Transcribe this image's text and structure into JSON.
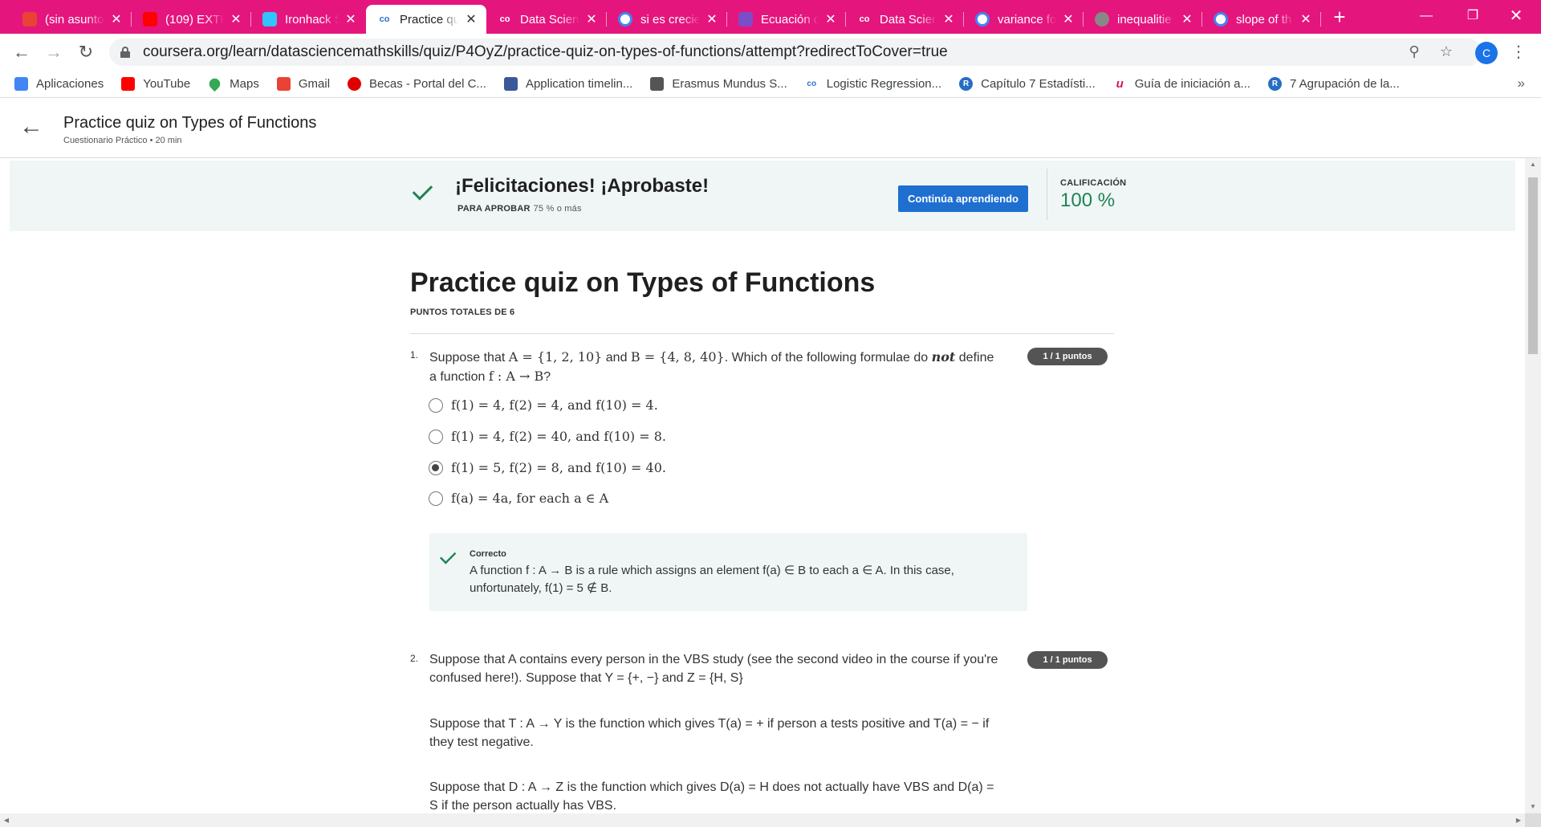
{
  "browser": {
    "tabs": [
      {
        "label": "(sin asunto",
        "favicon": "gmail-icon",
        "color": "#ea4335",
        "active": false
      },
      {
        "label": "(109) EXTR",
        "favicon": "youtube-icon",
        "color": "#ff0000",
        "active": false
      },
      {
        "label": "Ironhack S",
        "favicon": "ironhack-icon",
        "color": "#32c3ff",
        "active": false
      },
      {
        "label": "Practice qu",
        "favicon": "coursera-icon",
        "color": "#2a73cc",
        "active": true
      },
      {
        "label": "Data Scien",
        "favicon": "coursera-icon",
        "color": "#2a73cc",
        "active": false
      },
      {
        "label": "si es crecie",
        "favicon": "google-icon",
        "color": "#ffffff",
        "active": false
      },
      {
        "label": "Ecuación d",
        "favicon": "sparkle-icon",
        "color": "#7a4ec9",
        "active": false
      },
      {
        "label": "Data Scien",
        "favicon": "coursera-icon",
        "color": "#2a73cc",
        "active": false
      },
      {
        "label": "variance fo",
        "favicon": "google-icon",
        "color": "#ffffff",
        "active": false
      },
      {
        "label": "inequalitie",
        "favicon": "globe-icon",
        "color": "#888888",
        "active": false
      },
      {
        "label": "slope of th",
        "favicon": "google-icon",
        "color": "#ffffff",
        "active": false
      }
    ],
    "url_host": "coursera.org",
    "url_path": "/learn/datasciencemathskills/quiz/P4OyZ/practice-quiz-on-types-of-functions/attempt?redirectToCover=true",
    "avatar_letter": "C",
    "bookmarks": [
      {
        "label": "Aplicaciones",
        "icon": "apps-grid-icon",
        "color": "#4285f4"
      },
      {
        "label": "YouTube",
        "icon": "youtube-icon",
        "color": "#ff0000"
      },
      {
        "label": "Maps",
        "icon": "maps-pin-icon",
        "color": "#34a853"
      },
      {
        "label": "Gmail",
        "icon": "gmail-icon",
        "color": "#ea4335"
      },
      {
        "label": "Becas - Portal del C...",
        "icon": "red-circle-icon",
        "color": "#e00000"
      },
      {
        "label": "Application timelin...",
        "icon": "application-icon",
        "color": "#3b5998"
      },
      {
        "label": "Erasmus Mundus S...",
        "icon": "erasmus-icon",
        "color": "#555555"
      },
      {
        "label": "Logistic Regression...",
        "icon": "coursera-icon",
        "color": "#2a73cc"
      },
      {
        "label": "Capítulo 7 Estadísti...",
        "icon": "r-icon",
        "color": "#276dc3"
      },
      {
        "label": "Guía de iniciación a...",
        "icon": "u-icon",
        "color": "#e0115f"
      },
      {
        "label": "7 Agrupación de la...",
        "icon": "r-icon",
        "color": "#276dc3"
      }
    ]
  },
  "header": {
    "title": "Practice quiz on Types of Functions",
    "subtitle": "Cuestionario Práctico • 20 min"
  },
  "banner": {
    "title": "¡Felicitaciones! ¡Aprobaste!",
    "pass_label": "PARA APROBAR",
    "pass_value": "75 % o más",
    "continue_label": "Continúa aprendiendo",
    "grade_label": "CALIFICACIÓN",
    "grade_value": "100 %"
  },
  "quiz": {
    "title": "Practice quiz on Types of Functions",
    "total_points": "PUNTOS TOTALES DE 6",
    "q1": {
      "number": "1.",
      "points": "1 / 1 puntos",
      "text_a": "Suppose that",
      "set_a": "A = {1, 2, 10}",
      "text_and": "and",
      "set_b": "B = {4, 8, 40}",
      "text_b": ". Which of the following formulae do",
      "emph": "not",
      "text_c": "define a function",
      "func": "f : A → B",
      "text_d": "?",
      "options": [
        {
          "text": "f(1) = 4, f(2) = 4, and f(10) = 4.",
          "selected": false
        },
        {
          "text": "f(1) = 4, f(2) = 40, and f(10) = 8.",
          "selected": false
        },
        {
          "text": "f(1) = 5, f(2) = 8, and f(10) = 40.",
          "selected": true
        },
        {
          "text": "f(a) = 4a, for each a ∈ A",
          "selected": false
        }
      ],
      "feedback_label": "Correcto",
      "feedback_line1": "A function f : A → B is a rule which assigns an element f(a) ∈ B to each a ∈ A. In this case,",
      "feedback_line2": "unfortunately, f(1) = 5 ∉ B."
    },
    "q2": {
      "number": "2.",
      "points": "1 / 1 puntos",
      "p1_line1": "Suppose that A contains every person in the VBS study (see the second video in the course if you're",
      "p1_line2": "confused here!). Suppose that Y = {+, −} and Z = {H, S}",
      "p2_line1": "Suppose that T : A → Y is the function which gives T(a) = + if person a tests positive and T(a) = − if",
      "p2_line2": "they test negative.",
      "p3_line1": "Suppose that D : A → Z is the function which gives D(a) = H does not actually have VBS and D(a) =",
      "p3_line2": "S if the person actually has VBS."
    }
  },
  "colors": {
    "tabbar": "#e5157e",
    "accent_green": "#1f8354",
    "button_blue": "#1f6fd1",
    "banner_bg": "#f0f6f6",
    "badge_bg": "#545454"
  }
}
